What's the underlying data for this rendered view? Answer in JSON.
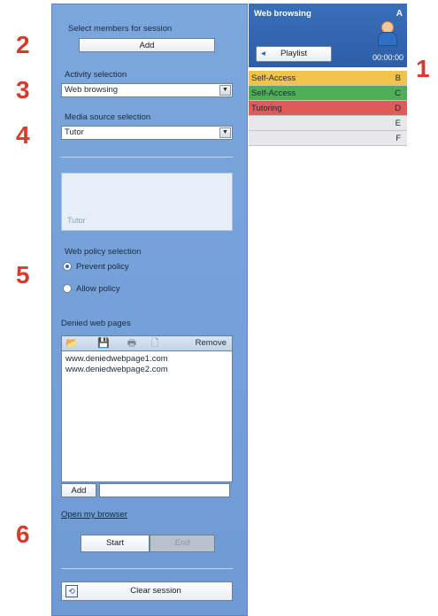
{
  "callouts": [
    "1",
    "2",
    "3",
    "4",
    "5",
    "6"
  ],
  "members": {
    "label": "Select members for session",
    "add_label": "Add"
  },
  "activity": {
    "label": "Activity selection",
    "value": "Web browsing"
  },
  "media": {
    "label": "Media source selection",
    "value": "Tutor"
  },
  "preview": {
    "caption": "Tutor"
  },
  "policy": {
    "label": "Web policy selection",
    "prevent_label": "Prevent policy",
    "allow_label": "Allow policy",
    "selected": "prevent"
  },
  "denied": {
    "label": "Denied web pages",
    "remove_label": "Remove",
    "items": [
      "www.deniedwebpage1.com",
      "www.deniedwebpage2.com"
    ],
    "add_label": "Add",
    "add_value": ""
  },
  "open_browser_label": "Open my browser",
  "controls": {
    "start_label": "Start",
    "end_label": "End"
  },
  "clear_label": "Clear session",
  "right_panel": {
    "title": "Web browsing",
    "letter": "A",
    "playlist_label": "Playlist",
    "time": "00:00:00",
    "rows": [
      {
        "label": "Self-Access",
        "letter": "B",
        "color": "#f2c34a"
      },
      {
        "label": "Self-Access",
        "letter": "C",
        "color": "#4fae57"
      },
      {
        "label": "Tutoring",
        "letter": "D",
        "color": "#e05a5a"
      },
      {
        "label": "",
        "letter": "E",
        "color": "#e8e8ea"
      },
      {
        "label": "",
        "letter": "F",
        "color": "#e8e8ea"
      }
    ]
  },
  "colors": {
    "panel": "#7ba7dd",
    "header": "#2c5ea6",
    "callout": "#d63b2b"
  }
}
